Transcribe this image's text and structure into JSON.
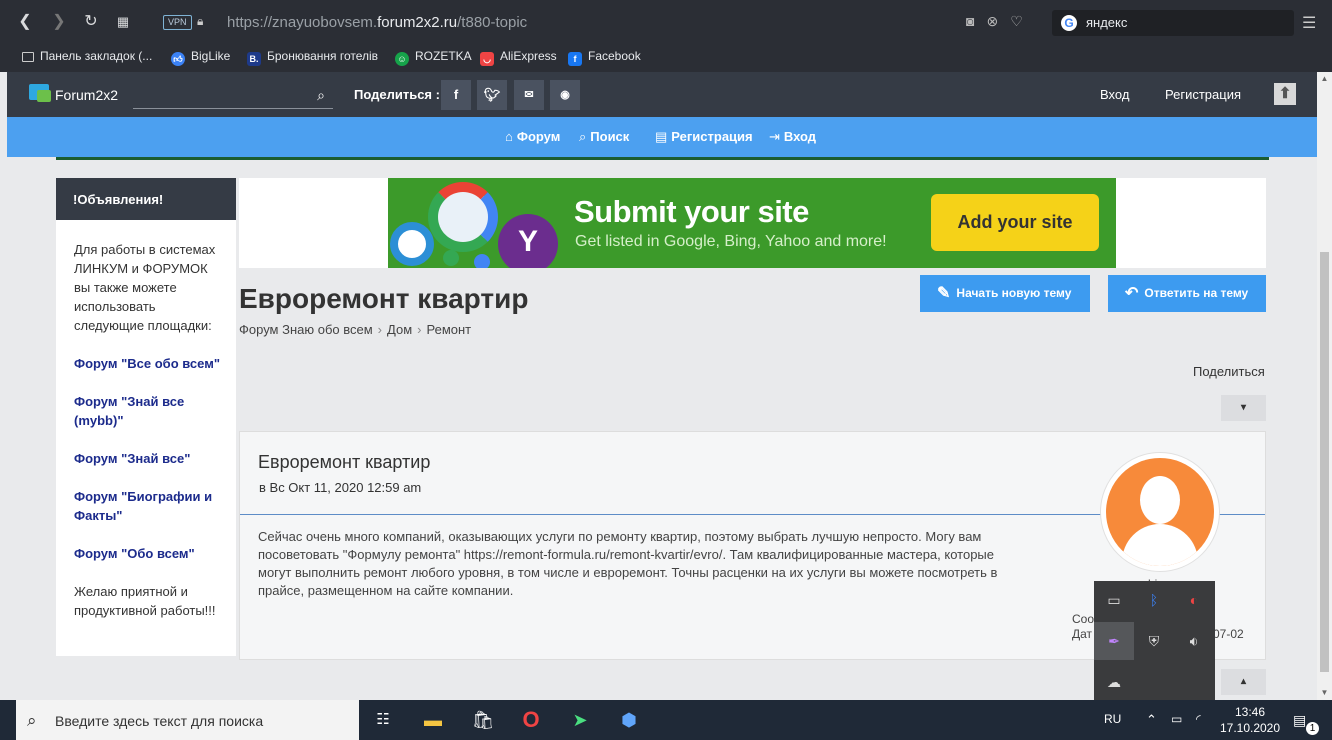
{
  "browser": {
    "vpn_badge": "VPN",
    "url_prefix": "https://znayuobovsem.",
    "url_domain": "forum2x2.ru",
    "url_path": "/t880-topic",
    "search_text": "яндекс",
    "bookmarks": [
      {
        "label": "Панель закладок (..."
      },
      {
        "label": "BigLike"
      },
      {
        "label": "Бронювання готелів"
      },
      {
        "label": "ROZETKA"
      },
      {
        "label": "AliExpress"
      },
      {
        "label": "Facebook"
      }
    ]
  },
  "forum_bar": {
    "logo_text": "Forum2x2",
    "share_label": "Поделиться :",
    "login": "Вход",
    "register": "Регистрация"
  },
  "blue_nav": {
    "items": [
      {
        "label": "Форум"
      },
      {
        "label": "Поиск"
      },
      {
        "label": "Регистрация"
      },
      {
        "label": "Вход"
      }
    ]
  },
  "sidebar": {
    "title": "!Объявления!",
    "intro": "Для работы в системах ЛИНКУМ и ФОРУМОК вы также можете использовать следующие площадки:",
    "links": [
      "Форум \"Все обо всем\"",
      "Форум \"Знай все (mybb)\"",
      "Форум \"Знай все\"",
      "Форум \"Биографии и Факты\"",
      "Форум \"Обо всем\""
    ],
    "footer": "Желаю приятной и продуктивной работы!!!"
  },
  "banner": {
    "title": "Submit your site",
    "subtitle": "Get listed in Google, Bing, Yahoo and more!",
    "button": "Add your site"
  },
  "topic": {
    "title": "Евроремонт квартир",
    "breadcrumb": [
      "Форум Знаю обо всем",
      "Дом",
      "Ремонт"
    ],
    "new_topic_button": "Начать новую тему",
    "reply_button": "Ответить на тему",
    "share": "Поделиться"
  },
  "post": {
    "title": "Евроремонт квартир",
    "date": "в Вс Окт 11, 2020 12:59 am",
    "text": "Сейчас очень много компаний, оказывающих услуги по ремонту квартир, поэтому выбрать лучшую непросто. Могу вам посоветовать \"Формулу ремонта\" https://remont-formula.ru/remont-kvartir/evro/. Там квалифицированные мастера, которые могут выполнить ремонт любого уровня, в том числе и евроремонт. Точны расценки на их услуги вы можете посмотреть в прайсе, размещенном на сайте компании.",
    "author_partial": "bing",
    "meta_line1": "Соо",
    "meta_line2": "Дат",
    "meta_date_partial": "07-02"
  },
  "taskbar": {
    "search_placeholder": "Введите здесь текст для поиска",
    "lang": "RU",
    "time": "13:46",
    "date": "17.10.2020",
    "notifications": "1"
  }
}
